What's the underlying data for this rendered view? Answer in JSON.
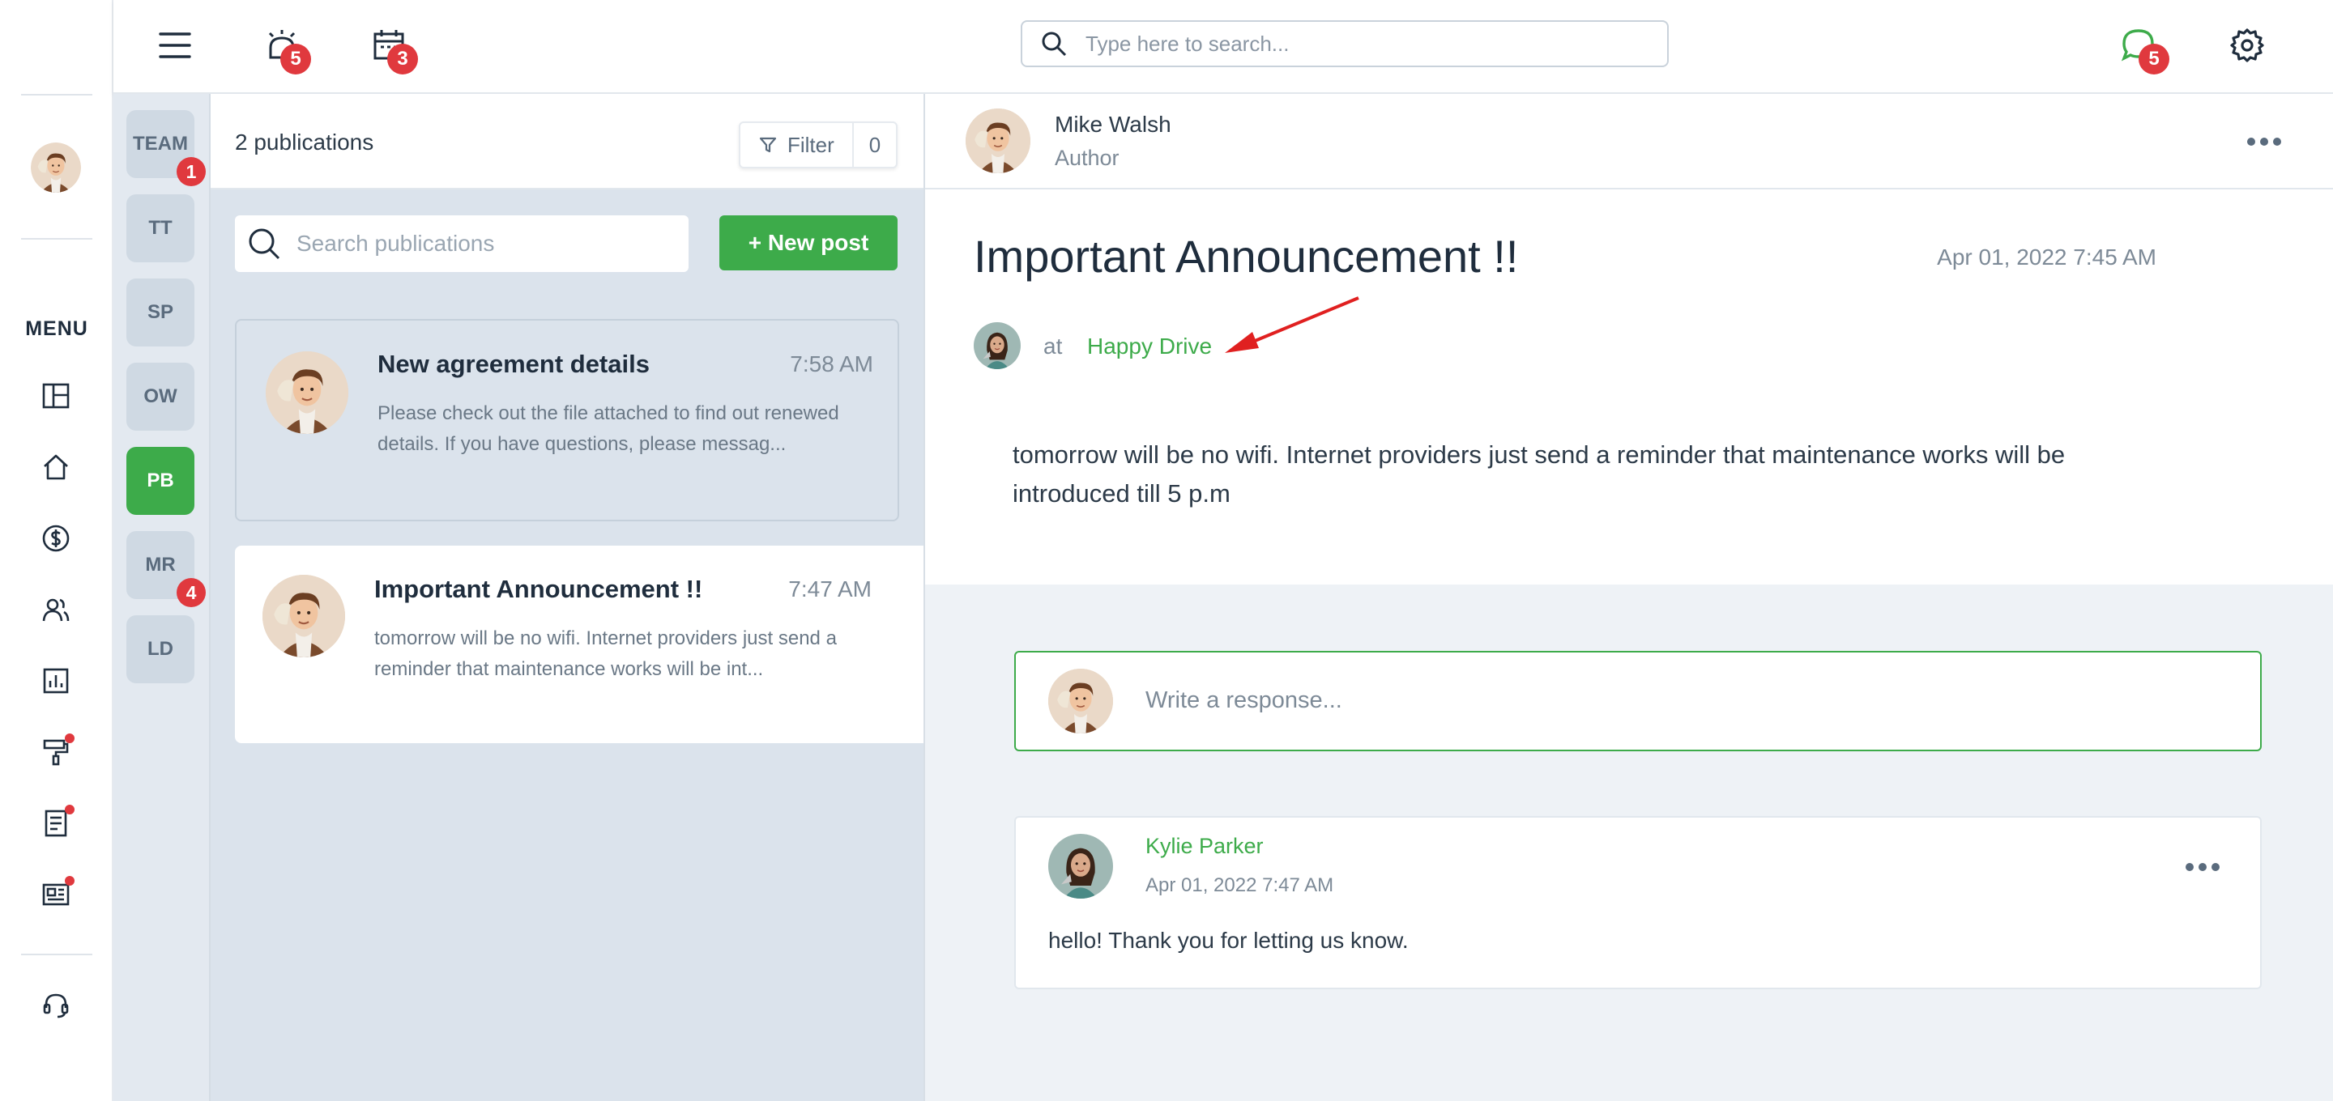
{
  "topbar": {
    "alarm_badge": "5",
    "calendar_badge": "3",
    "search_placeholder": "Type here to search...",
    "chat_badge": "5"
  },
  "leftnav": {
    "menu_label": "MENU",
    "items": [
      {
        "icon": "dashboard-icon",
        "dot": false
      },
      {
        "icon": "home-icon",
        "dot": false
      },
      {
        "icon": "dollar-icon",
        "dot": false
      },
      {
        "icon": "users-icon",
        "dot": false
      },
      {
        "icon": "chart-icon",
        "dot": false
      },
      {
        "icon": "paint-roller-icon",
        "dot": true
      },
      {
        "icon": "document-icon",
        "dot": true
      },
      {
        "icon": "newspaper-icon",
        "dot": true
      }
    ],
    "support_icon": "headset-icon"
  },
  "channels": [
    {
      "label": "TEAM",
      "badge": "1",
      "active": false
    },
    {
      "label": "TT",
      "badge": "",
      "active": false
    },
    {
      "label": "SP",
      "badge": "",
      "active": false
    },
    {
      "label": "OW",
      "badge": "",
      "active": false
    },
    {
      "label": "PB",
      "badge": "",
      "active": true
    },
    {
      "label": "MR",
      "badge": "4",
      "active": false
    },
    {
      "label": "LD",
      "badge": "",
      "active": false
    }
  ],
  "publications": {
    "count_label": "2 publications",
    "filter_label": "Filter",
    "filter_count": "0",
    "search_placeholder": "Search publications",
    "new_post_label": "+ New post",
    "items": [
      {
        "title": "New agreement details",
        "time": "7:58 AM",
        "excerpt": "Please check out the file attached to find out renewed details. If you have questions, please messag...",
        "selected": true
      },
      {
        "title": "Important Announcement !!",
        "time": "7:47 AM",
        "excerpt": "tomorrow will be no wifi. Internet providers just send a reminder that maintenance works will be int...",
        "selected": false
      }
    ]
  },
  "detail": {
    "author_name": "Mike Walsh",
    "author_role": "Author",
    "post_title": "Important Announcement !!",
    "post_date": "Apr 01, 2022 7:45 AM",
    "at_label": "at",
    "place": "Happy Drive",
    "post_body": "tomorrow will be no wifi. Internet providers just send a reminder that maintenance works will be introduced till 5 p.m",
    "response_placeholder": "Write a response...",
    "comment": {
      "name": "Kylie Parker",
      "date": "Apr 01, 2022 7:47 AM",
      "text": "hello! Thank you for letting us know."
    }
  },
  "colors": {
    "accent_green": "#3dab4a",
    "badge_red": "#e0393e",
    "annotation_arrow": "#e02020"
  }
}
